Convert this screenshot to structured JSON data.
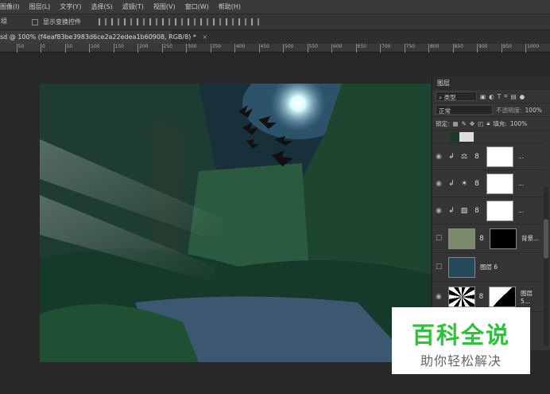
{
  "menu": [
    "图像(I)",
    "图层(L)",
    "文字(Y)",
    "选择(S)",
    "滤镜(T)",
    "视图(V)",
    "窗口(W)",
    "帮助(H)"
  ],
  "options": {
    "group_select": "组",
    "show_transform_label": "显示变换控件"
  },
  "document_tab": {
    "title": "sd @ 100% (f4eaf83be3983d6ce2a22edea1b60908, RGB/8) *",
    "close": "×"
  },
  "ruler_ticks": [
    "0",
    "50",
    "0",
    "50",
    "100",
    "150",
    "200",
    "250",
    "300",
    "350",
    "400",
    "450",
    "500",
    "550",
    "600",
    "650",
    "700",
    "750",
    "800",
    "850",
    "900",
    "950",
    "1000"
  ],
  "layers_panel": {
    "title": "图层",
    "filter_kind": "类型",
    "blend_mode": "正常",
    "opacity_label": "不透明度:",
    "opacity_value": "100%",
    "lock_label": "锁定:",
    "fill_label": "填充:",
    "fill_value": "100%",
    "layers": [
      {
        "name": "",
        "type": "partial"
      },
      {
        "name": "...",
        "type": "balance",
        "visible": true
      },
      {
        "name": "...",
        "type": "brightness",
        "visible": true
      },
      {
        "name": "...",
        "type": "curves",
        "visible": true
      },
      {
        "name": "背景...",
        "visible": false
      },
      {
        "name": "图层 6",
        "visible": false
      },
      {
        "name": "图层 5...",
        "visible": true
      }
    ]
  },
  "watermark": {
    "title": "百科全说",
    "subtitle": "助你轻松解决"
  }
}
